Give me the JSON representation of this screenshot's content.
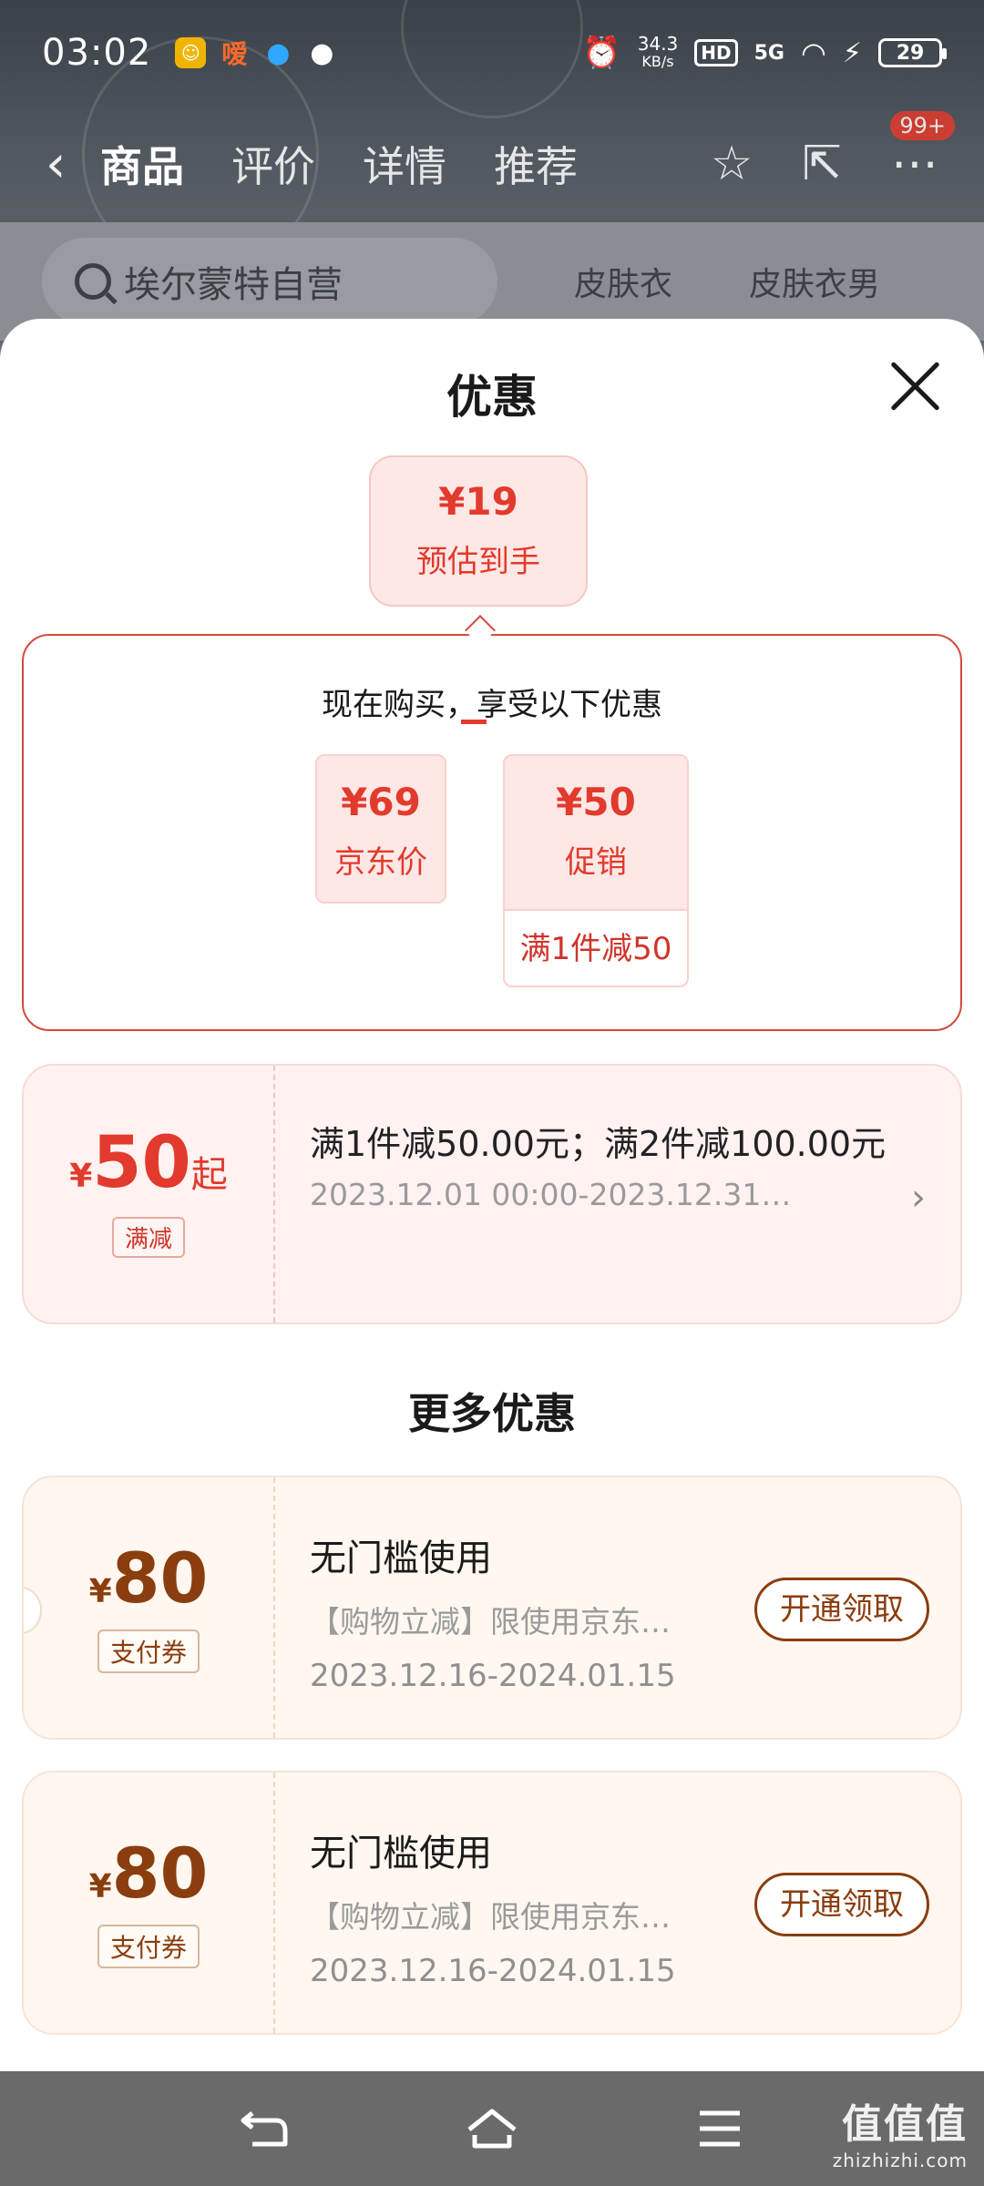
{
  "status_bar": {
    "time": "03:02",
    "app_hint": "嗳",
    "net_speed_top": "34.3",
    "net_speed_unit": "KB/s",
    "hd": "HD",
    "network": "5G",
    "battery": "29"
  },
  "product_nav": {
    "tabs": [
      "商品",
      "评价",
      "详情",
      "推荐"
    ],
    "badge": "99+"
  },
  "search": {
    "placeholder": "埃尔蒙特自营",
    "hot_words": [
      "皮肤衣",
      "皮肤衣男"
    ]
  },
  "sheet": {
    "title": "优惠",
    "estimate": {
      "price": "¥19",
      "label": "预估到手"
    },
    "calc": {
      "title": "现在购买，享受以下优惠",
      "jd_price": {
        "value": "¥69",
        "label": "京东价"
      },
      "minus": "-",
      "promo": {
        "value": "¥50",
        "label": "促销",
        "rule": "满1件减50"
      }
    },
    "promotion": {
      "yen": "¥",
      "amount": "50",
      "suffix": "起",
      "tag": "满减",
      "desc": "满1件减50.00元；满2件减100.00元",
      "time": "2023.12.01 00:00-2023.12.31…"
    },
    "more_title": "更多优惠",
    "coupons": [
      {
        "yen": "¥",
        "amount": "80",
        "tag": "支付券",
        "title": "无门槛使用",
        "desc": "【购物立减】限使用京东…",
        "time": "2023.12.16-2024.01.15",
        "button": "开通领取"
      },
      {
        "yen": "¥",
        "amount": "80",
        "tag": "支付券",
        "title": "无门槛使用",
        "desc": "【购物立减】限使用京东…",
        "time": "2023.12.16-2024.01.15",
        "button": "开通领取"
      }
    ]
  },
  "watermark": {
    "big": "值值值",
    "small": "zhizhizhi.com"
  },
  "colors": {
    "accent": "#e23a2c",
    "coupon_brown": "#8a3d0e",
    "promo_bg": "#fff2f1",
    "coupon_bg": "#fff7f0"
  },
  "icons": [
    "back-icon",
    "star-icon",
    "share-icon",
    "more-icon",
    "search-icon",
    "close-icon",
    "chevron-right-icon",
    "nav-back-icon",
    "nav-home-icon",
    "nav-menu-icon"
  ]
}
